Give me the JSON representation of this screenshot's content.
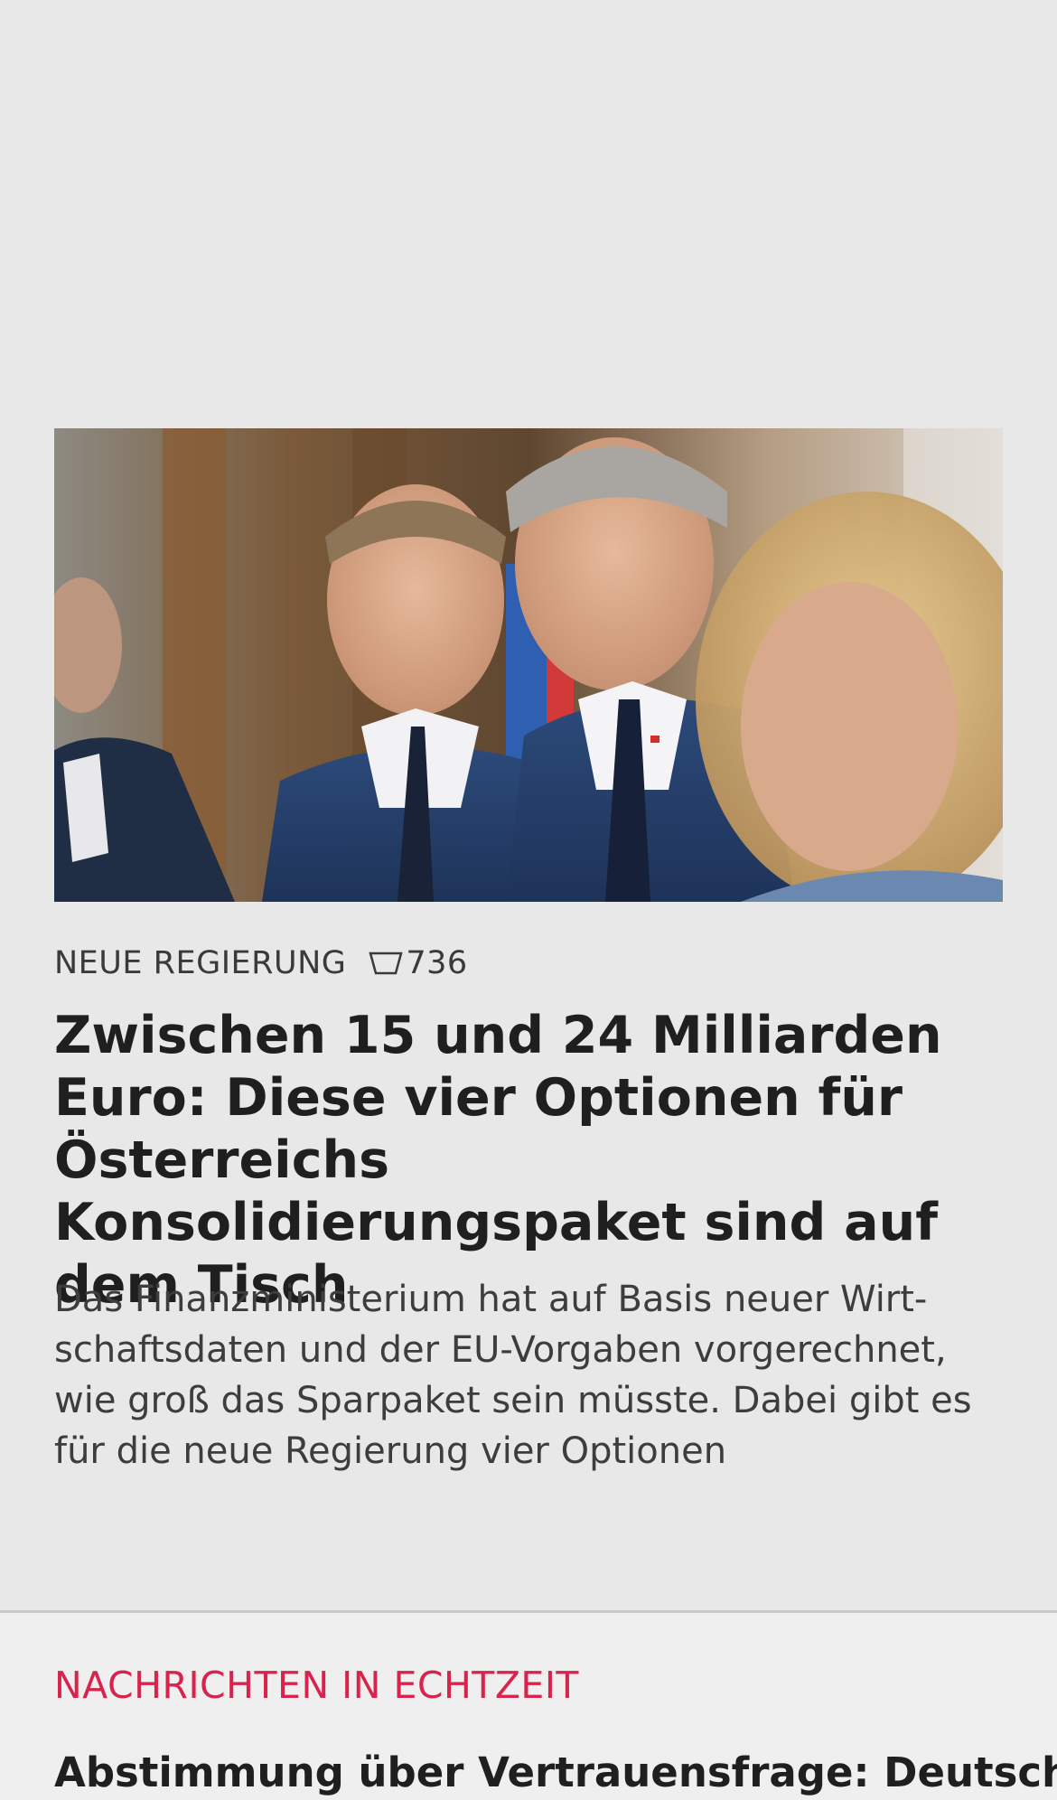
{
  "article": {
    "category": "NEUE REGIERUNG",
    "comment_count": "736",
    "headline": "Zwischen 15 und 24 Milliarden Euro: Diese vier Optionen für Österreichs Konsolidierungspaket sind auf dem Tisch",
    "teaser": "Das Finanzministerium hat auf Basis neuer Wirt-schaftsdaten und der EU-Vorgaben vorgerechnet, wie groß das Sparpaket sein müsste. Dabei gibt es für die neue Regierung vier Optionen"
  },
  "ticker": {
    "heading": "NACHRICHTEN IN ECHTZEIT",
    "first_item": "Abstimmung über Vertrauensfrage: Deutscher"
  },
  "colors": {
    "background": "#e8e8e8",
    "accent": "#d8234d",
    "text": "#1f1f1f"
  },
  "icons": {
    "comments": "comment-icon"
  }
}
